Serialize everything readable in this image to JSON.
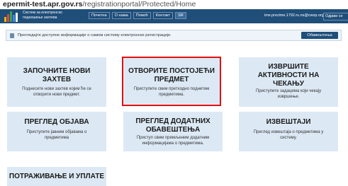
{
  "url": {
    "host": "epermit-test.apr.gov.rs",
    "path": "/registrationportal/Protected/Home"
  },
  "header": {
    "logo_text": "Систем за електронско подношење захтева",
    "nav": [
      "Почетна",
      "О нама",
      "Помоћ",
      "Контакт"
    ],
    "lang": "SR",
    "user": "ime.prezime.1792.ru.ns@cwop.org",
    "logout": "Одјави се"
  },
  "info": {
    "text": "Прегледајте доступне информације о самом систему електронске регистрације.",
    "button": "Обавештења"
  },
  "cards": [
    {
      "title": "ЗАПОЧНИТЕ НОВИ ЗАХТЕВ",
      "desc": "Поднесите нови захтев којим ће се отворити нови предмет."
    },
    {
      "title": "ОТВОРИТЕ ПОСТОЈЕЋИ ПРЕДМЕТ",
      "desc": "Приступите свим претходно поднетим предметима."
    },
    {
      "title": "ИЗВРШИТЕ АКТИВНОСТИ НА ЧЕКАЊУ",
      "desc": "Приступите задацима који чекају извршење."
    },
    {
      "title": "ПРЕГЛЕД ОБЈАВА",
      "desc": "Приступите јавним објавама о предметима"
    },
    {
      "title": "ПРЕГЛЕД ДОДАТНИХ ОБАВЕШТЕЊА",
      "desc": "Приступ свим примљеним додатним информацијама о предметима."
    },
    {
      "title": "ИЗВЕШТАЈИ",
      "desc": "Преглед извештаја о предметима у систему."
    },
    {
      "title": "ПОТРАЖИВАЊЕ И УПЛАТЕ",
      "desc": ""
    }
  ],
  "colors": {
    "header": "#1f4e79",
    "card": "#dce9f5",
    "highlight": "#e01010"
  }
}
